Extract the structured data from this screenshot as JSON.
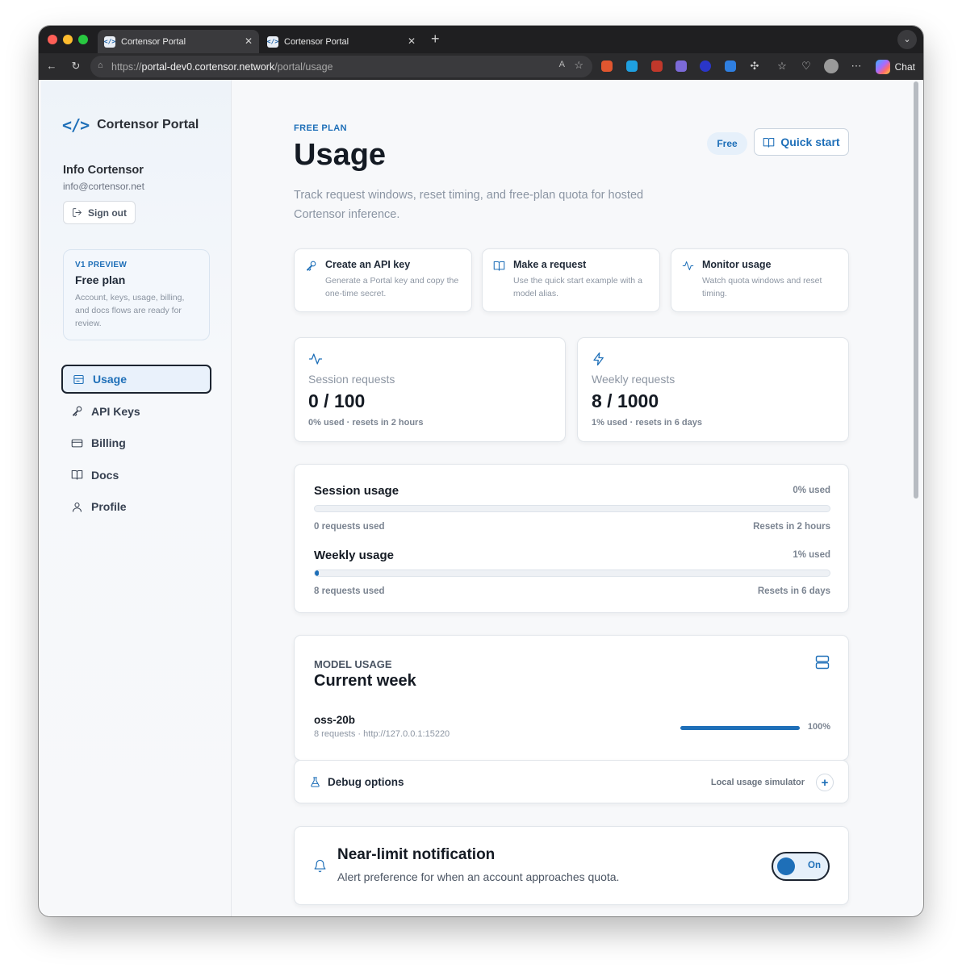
{
  "browser": {
    "tabs": [
      {
        "title": "Cortensor Portal"
      },
      {
        "title": "Cortensor Portal"
      }
    ],
    "url_scheme": "https://",
    "url_host": "portal-dev0.cortensor.network",
    "url_path": "/portal/usage",
    "chat_label": "Chat"
  },
  "sidebar": {
    "brand_code": "</>",
    "brand_name": "Cortensor Portal",
    "user_name": "Info Cortensor",
    "user_email": "info@cortensor.net",
    "signout_label": "Sign out",
    "preview": {
      "tag": "V1 PREVIEW",
      "plan": "Free plan",
      "description": "Account, keys, usage, billing, and docs flows are ready for review."
    },
    "nav": [
      {
        "label": "Usage",
        "icon": "usage-icon",
        "active": true
      },
      {
        "label": "API Keys",
        "icon": "key-icon"
      },
      {
        "label": "Billing",
        "icon": "credit-card-icon"
      },
      {
        "label": "Docs",
        "icon": "book-icon"
      },
      {
        "label": "Profile",
        "icon": "user-icon"
      }
    ]
  },
  "header": {
    "eyebrow": "FREE PLAN",
    "title": "Usage",
    "subtitle": "Track request windows, reset timing, and free-plan quota for hosted Cortensor inference.",
    "plan_badge": "Free",
    "quick_start_label": "Quick start"
  },
  "steps": [
    {
      "title": "Create an API key",
      "description": "Generate a Portal key and copy the one-time secret.",
      "icon": "key-icon"
    },
    {
      "title": "Make a request",
      "description": "Use the quick start example with a model alias.",
      "icon": "book-icon"
    },
    {
      "title": "Monitor usage",
      "description": "Watch quota windows and reset timing.",
      "icon": "activity-icon"
    }
  ],
  "stats": [
    {
      "label": "Session requests",
      "value": "0 / 100",
      "sub": "0% used · resets in 2 hours",
      "icon": "activity-icon"
    },
    {
      "label": "Weekly requests",
      "value": "8 / 1000",
      "sub": "1% used · resets in 6 days",
      "icon": "bolt-icon"
    }
  ],
  "usage": [
    {
      "title": "Session usage",
      "percent_label": "0% used",
      "fraction": 0.0,
      "used_label": "0 requests used",
      "reset_label": "Resets in 2 hours"
    },
    {
      "title": "Weekly usage",
      "percent_label": "1% used",
      "fraction": 0.008,
      "used_label": "8 requests used",
      "reset_label": "Resets in 6 days"
    }
  ],
  "model_usage": {
    "eyebrow": "MODEL USAGE",
    "title": "Current week",
    "model": "oss-20b",
    "meta": "8 requests · http://127.0.0.1:15220",
    "fraction": 1.0,
    "percent_label": "100%"
  },
  "debug": {
    "title": "Debug options",
    "right_label": "Local usage simulator",
    "expand_symbol": "+"
  },
  "notification": {
    "title": "Near-limit notification",
    "description": "Alert preference for when an account approaches quota.",
    "toggle_label": "On",
    "enabled": true
  },
  "colors": {
    "accent": "#1e6fb8",
    "text": "#141a23",
    "muted": "#8d96a3"
  }
}
